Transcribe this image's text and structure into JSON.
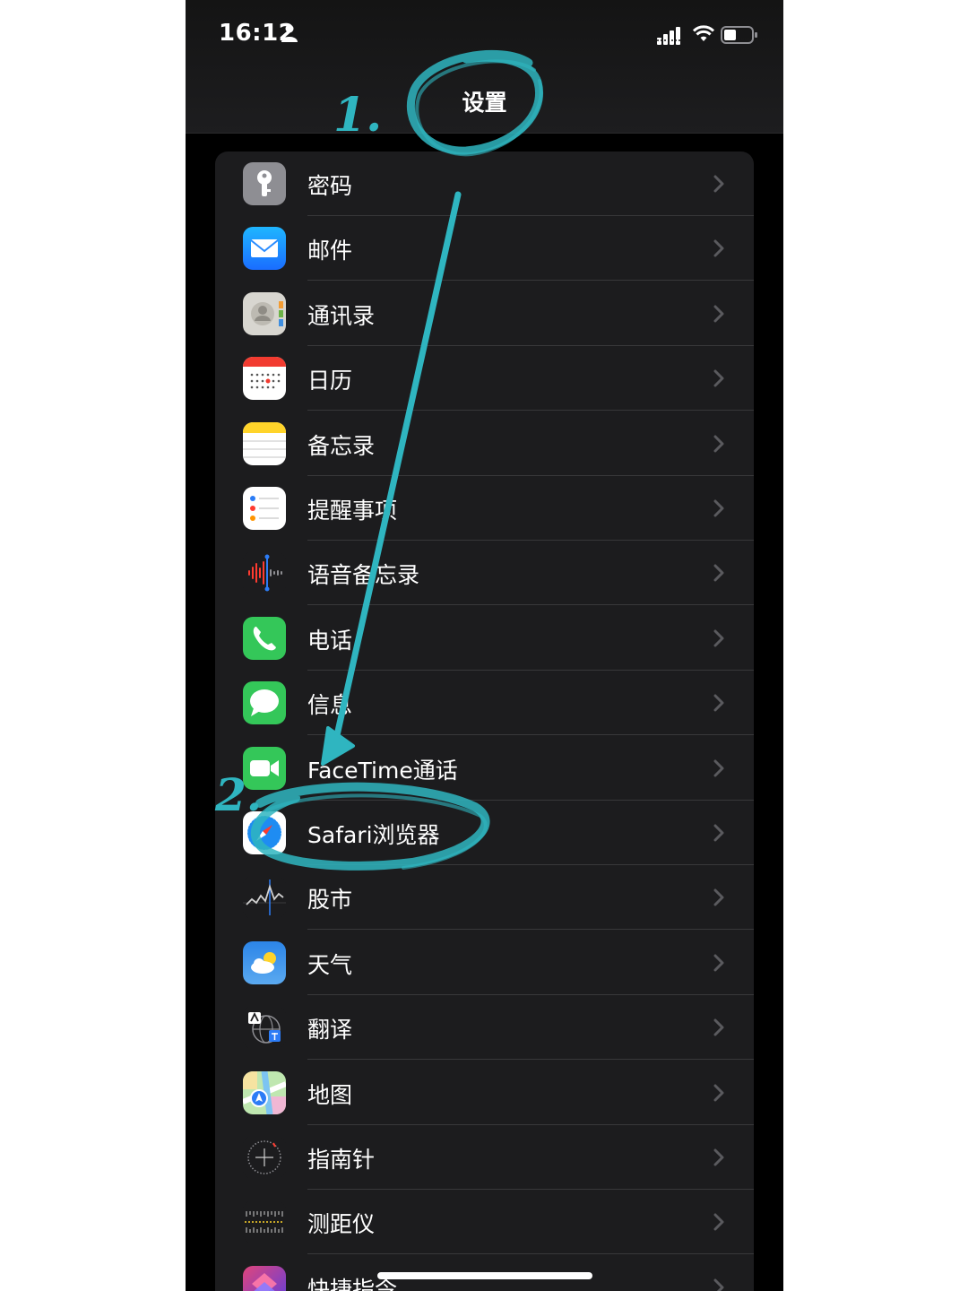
{
  "status_bar": {
    "time": "16:12"
  },
  "header": {
    "title": "设置"
  },
  "settings": {
    "items": [
      {
        "label": "密码",
        "icon": "key-icon"
      },
      {
        "label": "邮件",
        "icon": "mail-icon"
      },
      {
        "label": "通讯录",
        "icon": "contacts-icon"
      },
      {
        "label": "日历",
        "icon": "calendar-icon"
      },
      {
        "label": "备忘录",
        "icon": "notes-icon"
      },
      {
        "label": "提醒事项",
        "icon": "reminders-icon"
      },
      {
        "label": "语音备忘录",
        "icon": "voice-memos-icon"
      },
      {
        "label": "电话",
        "icon": "phone-icon"
      },
      {
        "label": "信息",
        "icon": "messages-icon"
      },
      {
        "label": "FaceTime通话",
        "icon": "facetime-icon"
      },
      {
        "label": "Safari浏览器",
        "icon": "safari-icon"
      },
      {
        "label": "股市",
        "icon": "stocks-icon"
      },
      {
        "label": "天气",
        "icon": "weather-icon"
      },
      {
        "label": "翻译",
        "icon": "translate-icon"
      },
      {
        "label": "地图",
        "icon": "maps-icon"
      },
      {
        "label": "指南针",
        "icon": "compass-icon"
      },
      {
        "label": "测距仪",
        "icon": "measure-icon"
      },
      {
        "label": "快捷指令",
        "icon": "shortcuts-icon"
      }
    ]
  },
  "annotations": {
    "step1": "1.",
    "step2": "2.",
    "marker_color": "#2fb5c0"
  },
  "colors": {
    "background": "#000000",
    "group_background": "#1c1c1e",
    "separator": "#38383a",
    "chevron": "#5a5a5e"
  }
}
